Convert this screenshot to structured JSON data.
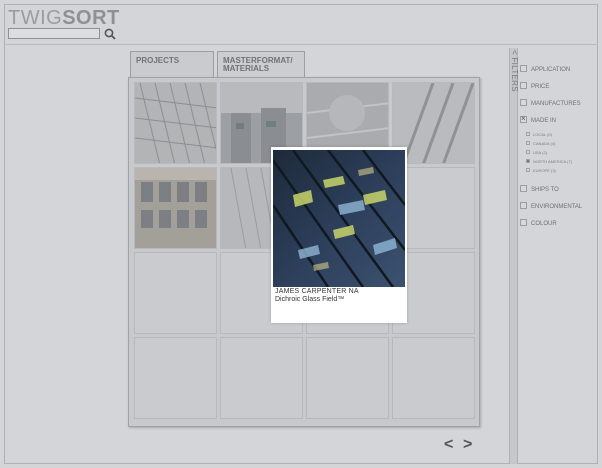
{
  "header": {
    "logo_light": "TWIG",
    "logo_bold": "SORT",
    "search_value": ""
  },
  "tabs": [
    {
      "label": "PROJECTS"
    },
    {
      "label_line1": "MASTERFORMAT/",
      "label_line2": "MATERIALS"
    }
  ],
  "popup": {
    "company": "JAMES CARPENTER NA",
    "product": "Dichroic Glass Field™"
  },
  "pager": {
    "prev": "<",
    "next": ">"
  },
  "filters": {
    "label": "< FILTERS",
    "items": [
      {
        "label": "APPLICATION",
        "checked": false
      },
      {
        "label": "PRICE",
        "checked": false
      },
      {
        "label": "MANUFACTURES",
        "checked": false
      },
      {
        "label": "MADE IN",
        "checked": true
      },
      {
        "label": "SHIPS TO",
        "checked": false
      },
      {
        "label": "ENVIRONMENTAL",
        "checked": false
      },
      {
        "label": "COLOUR",
        "checked": false
      }
    ],
    "made_in_options": [
      {
        "label": "LOCAL (0)",
        "checked": false
      },
      {
        "label": "CANADA (4)",
        "checked": false
      },
      {
        "label": "USA (2)",
        "checked": false
      },
      {
        "label": "NORTH AMERICA (7)",
        "checked": true
      },
      {
        "label": "EUROPE (3)",
        "checked": false
      }
    ]
  },
  "colors": {
    "background": "#d4d5d7",
    "panel": "#c7c9cd",
    "popup_bg": "#ffffff"
  }
}
